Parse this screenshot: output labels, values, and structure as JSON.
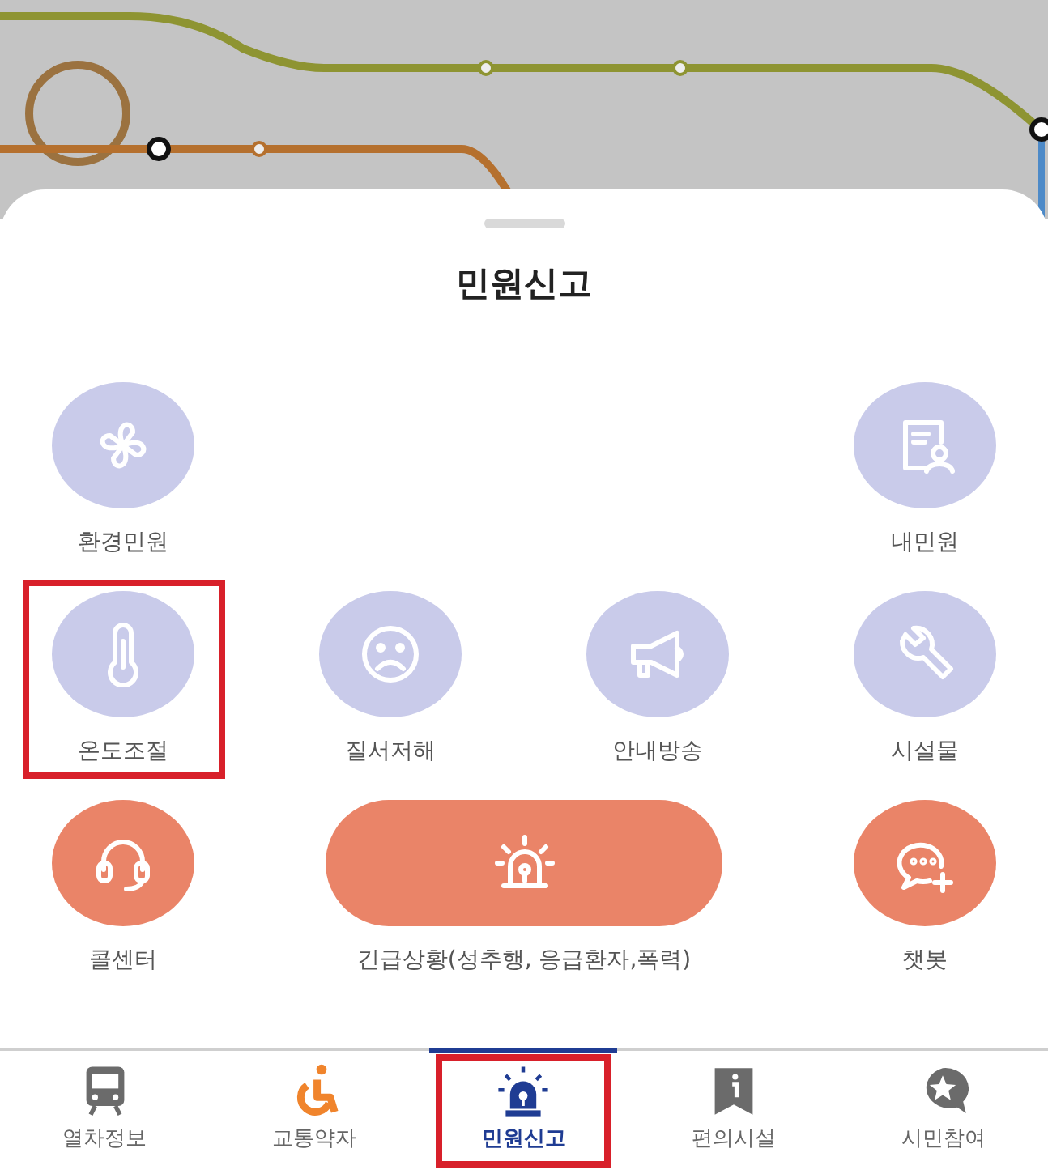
{
  "sheet": {
    "title": "민원신고"
  },
  "rows": [
    {
      "items": [
        {
          "label": "환경민원",
          "kind": "round",
          "color": "#c9cbea",
          "highlighted": false
        },
        {
          "label": "내민원",
          "kind": "round",
          "color": "#c9cbea",
          "highlighted": false
        }
      ]
    },
    {
      "items": [
        {
          "label": "온도조절",
          "kind": "round",
          "color": "#c9cbea",
          "highlighted": true
        },
        {
          "label": "질서저해",
          "kind": "round",
          "color": "#c9cbea",
          "highlighted": false
        },
        {
          "label": "안내방송",
          "kind": "round",
          "color": "#c9cbea",
          "highlighted": false
        },
        {
          "label": "시설물",
          "kind": "round",
          "color": "#c9cbea",
          "highlighted": false
        }
      ]
    },
    {
      "items": [
        {
          "label": "콜센터",
          "kind": "round",
          "color": "#ea8468",
          "highlighted": false
        },
        {
          "label": "긴급상황(성추행, 응급환자,폭력)",
          "kind": "wide",
          "color": "#ea8468",
          "highlighted": false
        },
        {
          "label": "챗봇",
          "kind": "round",
          "color": "#ea8468",
          "highlighted": false
        }
      ]
    }
  ],
  "nav": [
    {
      "label": "열차정보",
      "selected": false,
      "highlighted": false
    },
    {
      "label": "교통약자",
      "selected": false,
      "highlighted": false
    },
    {
      "label": "민원신고",
      "selected": true,
      "highlighted": true
    },
    {
      "label": "편의시설",
      "selected": false,
      "highlighted": false
    },
    {
      "label": "시민참여",
      "selected": false,
      "highlighted": false
    }
  ]
}
